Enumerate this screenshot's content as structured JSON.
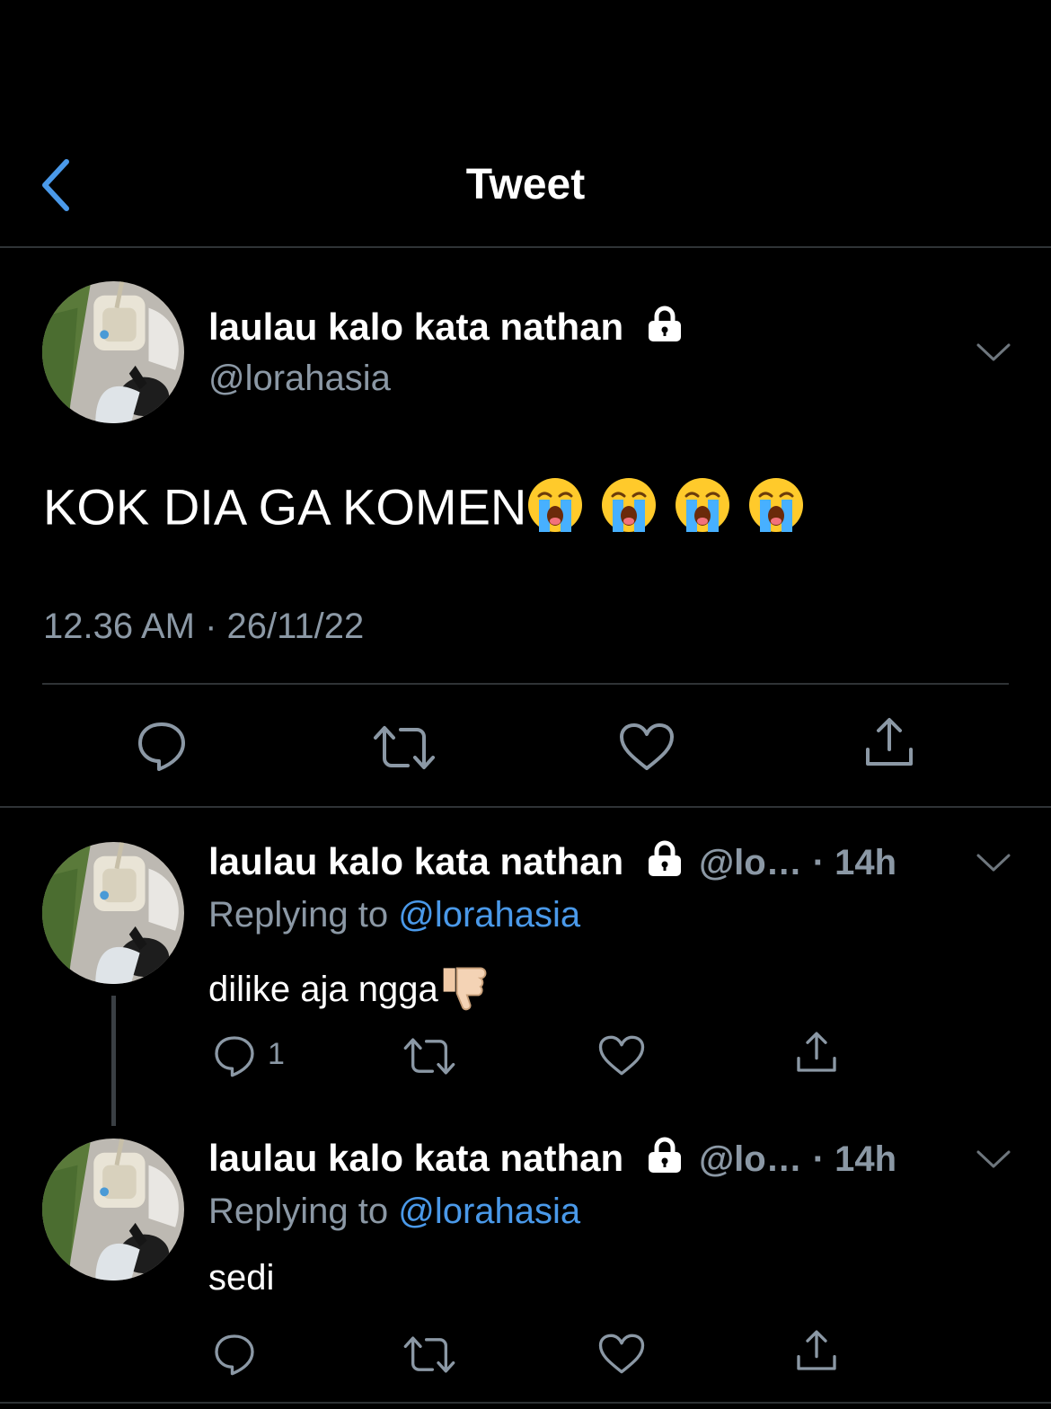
{
  "header": {
    "title": "Tweet"
  },
  "main_tweet": {
    "display_name": "laulau kalo kata nathan",
    "handle": "@lorahasia",
    "text": "KOK DIA GA KOMEN",
    "emoji": "😭 😭 😭 😭",
    "timestamp": "12.36 AM · 26/11/22"
  },
  "replies": [
    {
      "display_name": "laulau kalo kata nathan",
      "handle_short": "@lo…",
      "time": "· 14h",
      "replying_prefix": "Replying to",
      "replying_to": "@lorahasia",
      "text": "dilike aja ngga",
      "emoji": "👎",
      "reply_count": "1"
    },
    {
      "display_name": "laulau kalo kata nathan",
      "handle_short": "@lo…",
      "time": "· 14h",
      "replying_prefix": "Replying to",
      "replying_to": "@lorahasia",
      "text": "sedi",
      "emoji": "",
      "reply_count": ""
    }
  ],
  "colors": {
    "background": "#000000",
    "secondary_text": "#8b98a5",
    "link": "#4a99e9",
    "divider": "#2f3336"
  },
  "icons": [
    "back-chevron-icon",
    "lock-icon",
    "chevron-down-icon",
    "reply-icon",
    "retweet-icon",
    "like-icon",
    "share-icon",
    "crying-face-emoji",
    "thumbs-down-emoji"
  ]
}
